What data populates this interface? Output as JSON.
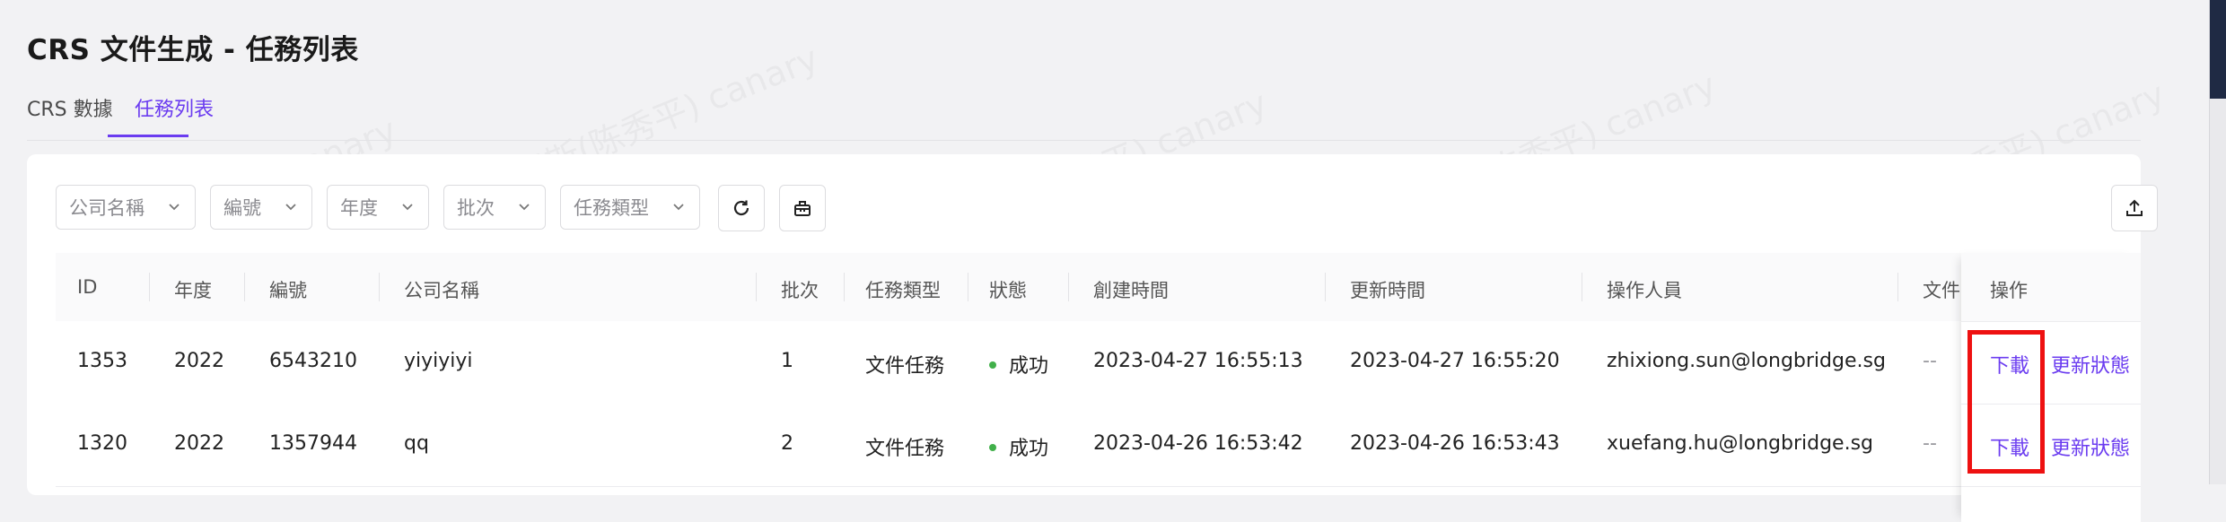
{
  "page": {
    "title": "CRS 文件生成 - 任務列表"
  },
  "tabs": [
    {
      "label": "CRS 數據",
      "active": false
    },
    {
      "label": "任務列表",
      "active": true
    }
  ],
  "filters": [
    {
      "placeholder": "公司名稱"
    },
    {
      "placeholder": "編號"
    },
    {
      "placeholder": "年度"
    },
    {
      "placeholder": "批次"
    },
    {
      "placeholder": "任務類型"
    }
  ],
  "toolbar": {
    "refresh_icon": "refresh-icon",
    "clear_icon": "clear-icon",
    "export_icon": "upload-icon"
  },
  "table": {
    "columns": [
      "ID",
      "年度",
      "編號",
      "公司名稱",
      "批次",
      "任務類型",
      "狀態",
      "創建時間",
      "更新時間",
      "操作人員",
      "文件",
      "操作"
    ],
    "rows": [
      {
        "id": "1353",
        "year": "2022",
        "code": "6543210",
        "company": "yiyiyiyi",
        "batch": "1",
        "type": "文件任務",
        "status": "成功",
        "created": "2023-04-27 16:55:13",
        "updated": "2023-04-27 16:55:20",
        "operator": "zhixiong.sun@longbridge.sg",
        "file": "--",
        "download": "下載",
        "update_status": "更新狀態"
      },
      {
        "id": "1320",
        "year": "2022",
        "code": "1357944",
        "company": "qq",
        "batch": "2",
        "type": "文件任務",
        "status": "成功",
        "created": "2023-04-26 16:53:42",
        "updated": "2023-04-26 16:53:43",
        "operator": "xuefang.hu@longbridge.sg",
        "file": "--",
        "download": "下載",
        "update_status": "更新狀態"
      }
    ]
  },
  "watermark": "汉斯(陈秀平) canary",
  "colors": {
    "accent": "#6b3cf0",
    "success": "#41b04a",
    "highlight": "#ee1111"
  }
}
